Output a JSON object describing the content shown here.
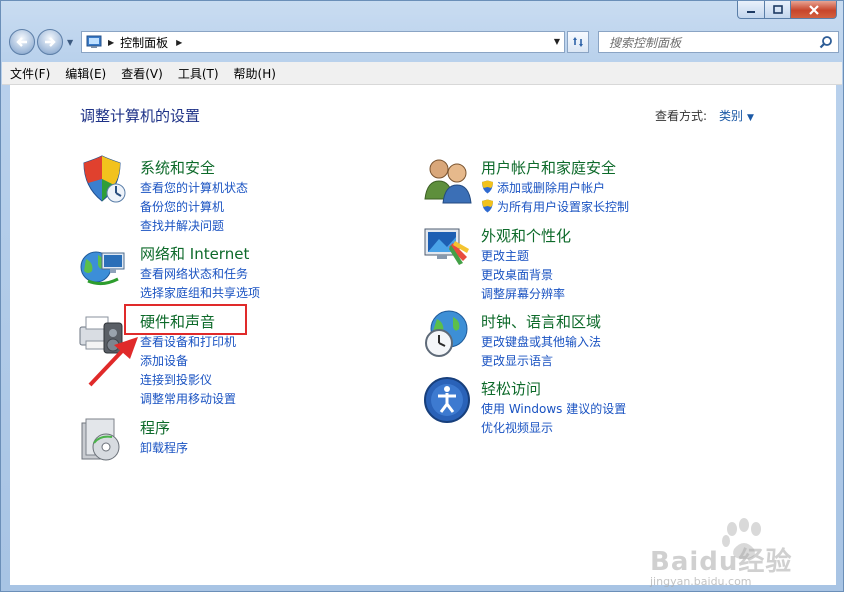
{
  "window": {
    "caption_buttons": [
      "minimize-icon",
      "maximize-icon",
      "close-icon"
    ]
  },
  "address_bar": {
    "breadcrumb": "控制面板",
    "search_placeholder": "搜索控制面板"
  },
  "menu": [
    "文件(F)",
    "编辑(E)",
    "查看(V)",
    "工具(T)",
    "帮助(H)"
  ],
  "content": {
    "title": "调整计算机的设置",
    "view_by_label": "查看方式:",
    "view_by_value": "类别"
  },
  "categories": {
    "system": {
      "title": "系统和安全",
      "links": [
        "查看您的计算机状态",
        "备份您的计算机",
        "查找并解决问题"
      ]
    },
    "network": {
      "title": "网络和 Internet",
      "links": [
        "查看网络状态和任务",
        "选择家庭组和共享选项"
      ]
    },
    "hardware": {
      "title": "硬件和声音",
      "links": [
        "查看设备和打印机",
        "添加设备",
        "连接到投影仪",
        "调整常用移动设置"
      ]
    },
    "programs": {
      "title": "程序",
      "links": [
        "卸载程序"
      ]
    },
    "users": {
      "title": "用户帐户和家庭安全",
      "links": [
        "添加或删除用户帐户",
        "为所有用户设置家长控制"
      ]
    },
    "appearance": {
      "title": "外观和个性化",
      "links": [
        "更改主题",
        "更改桌面背景",
        "调整屏幕分辨率"
      ]
    },
    "clock": {
      "title": "时钟、语言和区域",
      "links": [
        "更改键盘或其他输入法",
        "更改显示语言"
      ]
    },
    "ease": {
      "title": "轻松访问",
      "links": [
        "使用 Windows 建议的设置",
        "优化视频显示"
      ]
    }
  },
  "watermark": {
    "brand": "Baidu经验",
    "url": "jingyan.baidu.com"
  },
  "colors": {
    "category_title": "#0d6a2a",
    "link": "#1a53c2",
    "heading": "#1e3287",
    "annotation": "#e02a2a"
  }
}
